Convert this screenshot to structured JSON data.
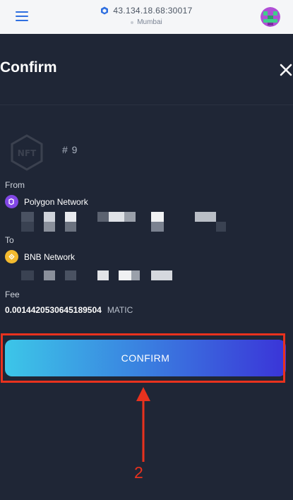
{
  "topbar": {
    "address": "43.134.18.68:30017",
    "network_name": "Mumbai"
  },
  "modal": {
    "title": "Confirm",
    "nft_id": "# 9",
    "from_label": "From",
    "from_network": "Polygon Network",
    "to_label": "To",
    "to_network": "BNB Network",
    "fee_label": "Fee",
    "fee_value": "0.0014420530645189504",
    "fee_unit": "MATIC",
    "confirm_label": "CONFIRM"
  },
  "annotation": {
    "step_number": "2"
  },
  "colors": {
    "background": "#1f2636",
    "topbar": "#f5f6f8",
    "accent_blue": "#2f6fe0",
    "highlight_red": "#e8321e",
    "polygon_purple": "#8247e5",
    "bnb_yellow": "#f3ba2f"
  },
  "icons": [
    "menu-icon",
    "network-cube-icon",
    "avatar-icon",
    "close-icon",
    "nft-logo-icon",
    "polygon-icon",
    "bnb-icon",
    "arrow-up-icon"
  ]
}
